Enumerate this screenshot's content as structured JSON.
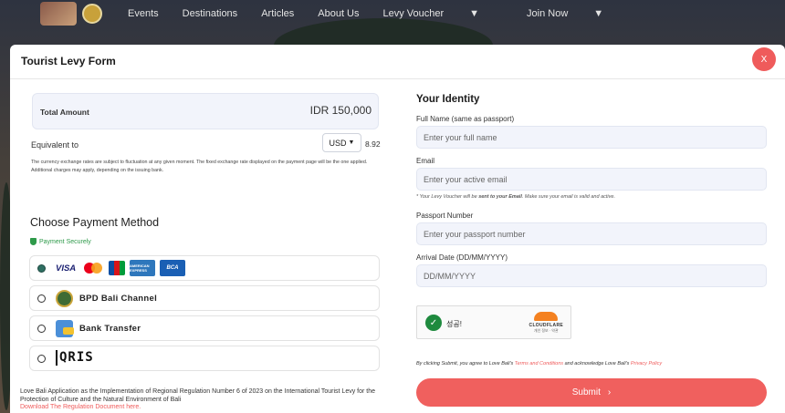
{
  "nav": {
    "items": [
      "Events",
      "Destinations",
      "Articles",
      "About Us",
      "Levy Voucher",
      "Join Now"
    ]
  },
  "modal": {
    "title": "Tourist Levy Form",
    "close_label": "X"
  },
  "amount": {
    "label": "Total Amount",
    "value": "IDR 150,000",
    "equivalent_label": "Equivalent to",
    "currency": "USD",
    "rate": "8.92",
    "note": "The currency exchange rates are subject to fluctuation at any given moment. The fixed exchange rate displayed on the payment page will be the one applied. Additional charges may apply, depending on the issuing bank."
  },
  "payment": {
    "title": "Choose Payment Method",
    "secure_label": "Payment Securely",
    "card_labels": {
      "visa": "VISA",
      "amex": "AMERICAN EXPRESS",
      "bca": "BCA"
    },
    "options": [
      {
        "label": "",
        "selected": true
      },
      {
        "label": "BPD Bali Channel",
        "selected": false
      },
      {
        "label": "Bank Transfer",
        "selected": false
      },
      {
        "label": "QRIS",
        "selected": false
      }
    ]
  },
  "regulation": {
    "text": "Love Bali Application as the Implementation of Regional Regulation Number 6 of 2023 on the International Tourist Levy for the Protection of Culture and the Natural Environment of Bali",
    "link": "Download The Regulation Document here."
  },
  "identity": {
    "title": "Your Identity",
    "full_name_label": "Full Name (same as passport)",
    "full_name_placeholder": "Enter your full name",
    "email_label": "Email",
    "email_placeholder": "Enter your active email",
    "email_hint_pre": "* Your Levy Voucher will be ",
    "email_hint_bold": "sent to your Email",
    "email_hint_post": ". Make sure your email is valid and active.",
    "passport_label": "Passport Number",
    "passport_placeholder": "Enter your passport number",
    "arrival_label": "Arrival Date (DD/MM/YYYY)",
    "arrival_placeholder": "DD/MM/YYYY"
  },
  "captcha": {
    "status": "성공!",
    "brand": "CLOUDFLARE",
    "links": "개인 정보 · 약관"
  },
  "terms": {
    "pre": "By clicking Submit, you agree to Love Bali's ",
    "tc": "Terms and Conditions",
    "mid": " and acknowledge Love Bali's ",
    "privacy": "Privacy Policy"
  },
  "submit_label": "Submit"
}
